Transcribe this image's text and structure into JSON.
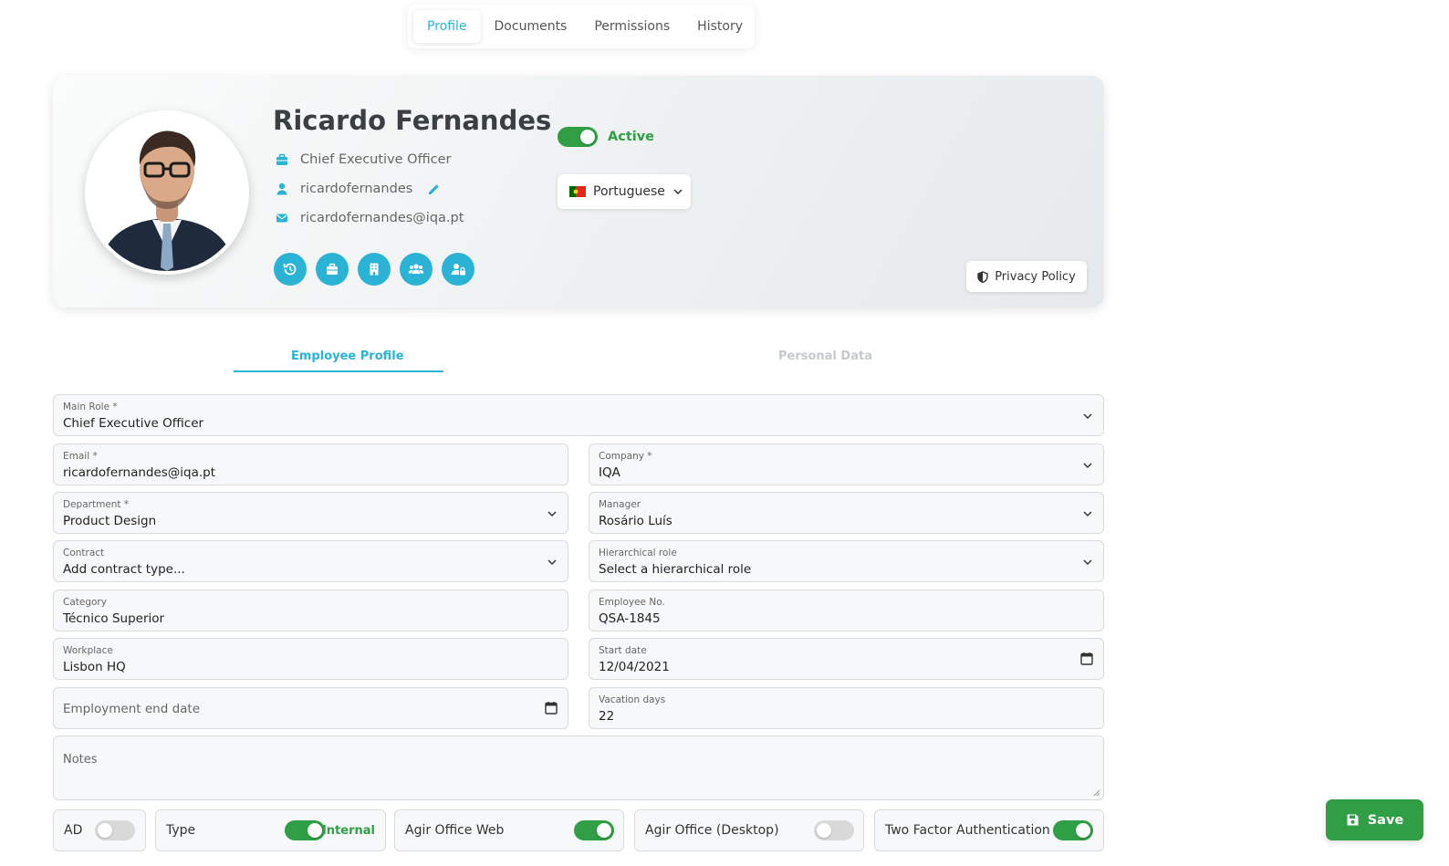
{
  "top_tabs": [
    {
      "label": "Profile",
      "active": true
    },
    {
      "label": "Documents",
      "active": false
    },
    {
      "label": "Permissions",
      "active": false
    },
    {
      "label": "History",
      "active": false
    }
  ],
  "profile": {
    "name": "Ricardo Fernandes",
    "job_title": "Chief Executive Officer",
    "username": "ricardofernandes",
    "email": "ricardofernandes@iqa.pt",
    "status_label": "Active",
    "status_on": true,
    "language": "Portuguese",
    "privacy_policy_label": "Privacy Policy",
    "action_icons": [
      "history-icon",
      "briefcase-icon",
      "building-icon",
      "users-icon",
      "user-lock-icon"
    ]
  },
  "section_tabs": {
    "employee_profile": "Employee Profile",
    "personal_data": "Personal Data"
  },
  "form": {
    "main_role": {
      "label": "Main Role *",
      "value": "Chief Executive Officer"
    },
    "email": {
      "label": "Email *",
      "value": "ricardofernandes@iqa.pt"
    },
    "company": {
      "label": "Company *",
      "value": "IQA"
    },
    "department": {
      "label": "Department *",
      "value": "Product Design"
    },
    "manager": {
      "label": "Manager",
      "value": "Rosário Luís"
    },
    "contract": {
      "label": "Contract",
      "value": "Add contract type..."
    },
    "hierarchical_role": {
      "label": "Hierarchical role",
      "value": "Select a hierarchical role"
    },
    "category": {
      "label": "Category",
      "value": "Técnico Superior"
    },
    "employee_no": {
      "label": "Employee No.",
      "value": "QSA-1845"
    },
    "workplace": {
      "label": "Workplace",
      "value": "Lisbon HQ"
    },
    "start_date": {
      "label": "Start date",
      "value": "12/04/2021"
    },
    "employment_end_date": {
      "placeholder": "Employment end date"
    },
    "vacation_days": {
      "label": "Vacation days",
      "value": "22"
    },
    "notes": {
      "placeholder": "Notes"
    }
  },
  "toggles": {
    "ad": {
      "label": "AD",
      "on": false
    },
    "type": {
      "label": "Type",
      "on": true,
      "value": "Internal"
    },
    "agir_office_web": {
      "label": "Agir Office Web",
      "on": true
    },
    "agir_office_desktop": {
      "label": "Agir Office (Desktop)",
      "on": false
    },
    "two_factor": {
      "label": "Two Factor Authentication",
      "on": true
    }
  },
  "save_label": "Save",
  "colors": {
    "accent": "#2bb3d6",
    "success": "#2f9e44",
    "muted_tab": "#c5c9cc"
  }
}
